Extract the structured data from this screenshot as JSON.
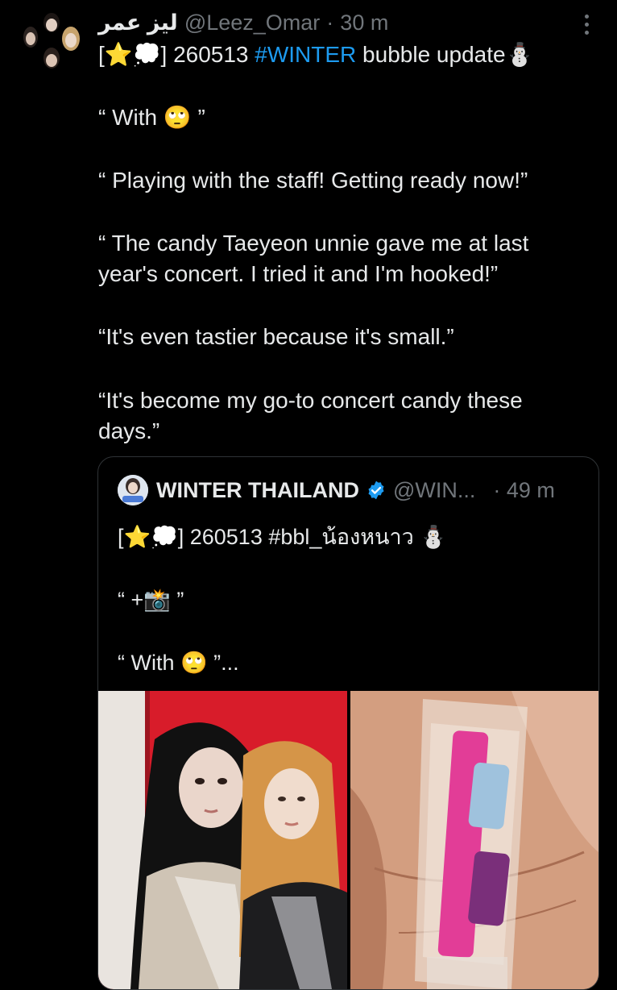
{
  "tweet": {
    "display_name": "ليز عمر",
    "handle": "@Leez_Omar",
    "separator": "·",
    "time": "30 m",
    "line1_prefix": "[⭐💭] 260513 ",
    "hashtag": "#WINTER",
    "line1_suffix": " bubble update⛄",
    "quote1": "“ With 🙄 ”",
    "quote2": "“ Playing with the staff! Getting ready now!”",
    "quote3a": "“ The candy Taeyeon unnie gave me at last",
    "quote3b": "year's concert. I tried it and I'm hooked!”",
    "quote4": "“It's even tastier because it's small.”",
    "quote5a": "“It's become my go-to concert candy these",
    "quote5b": "days.”"
  },
  "quoted_tweet": {
    "display_name": "WINTER THAILAND",
    "handle": "@WIN...",
    "time": "· 49 m",
    "line1": "[⭐💭] 260513 #bbl_น้องหนาว ⛄",
    "line2": "“ +📸 ”",
    "line3": "“ With 🙄 ”..."
  },
  "icons": {
    "more": "more-options-icon",
    "verified": "verified-badge-icon"
  },
  "colors": {
    "background": "#000000",
    "text": "#e7e9ea",
    "secondary": "#71767b",
    "accent": "#1d9bf0",
    "border": "#2f3336"
  }
}
